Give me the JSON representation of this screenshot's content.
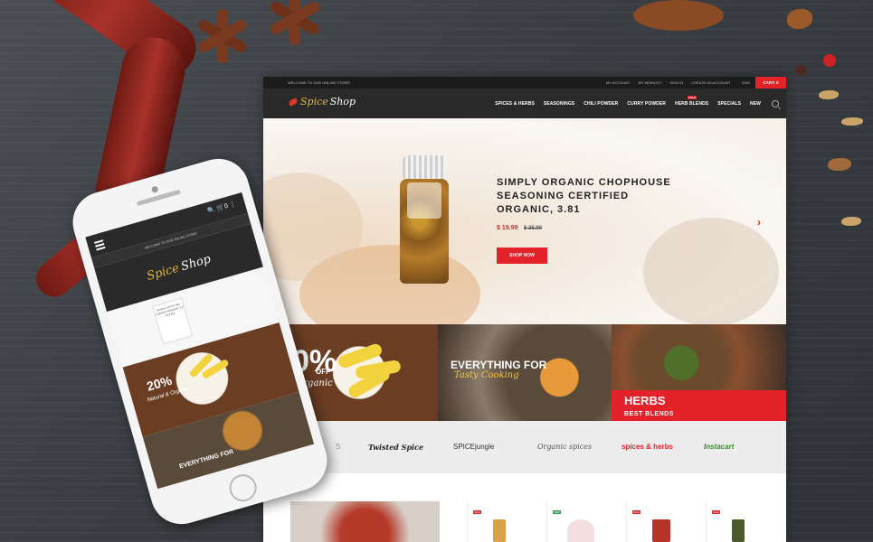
{
  "site": {
    "welcome": "WELCOME TO OUR ONLINE STORE!",
    "top_links": [
      "MY ACCOUNT",
      "MY WISHLIST",
      "SIGN IN",
      "CREATE AN ACCOUNT"
    ],
    "lang": "ENG",
    "cart": "CART: 0",
    "logo_part1": "Spice",
    "logo_part2": "Shop",
    "menu": [
      "SPICES & HERBS",
      "SEASONINGS",
      "CHILI POWDER",
      "CURRY POWDER",
      "HERB BLENDS",
      "SPECIALS",
      "NEW"
    ],
    "menu_badge": "SALE"
  },
  "hero": {
    "title": "SIMPLY ORGANIC CHOPHOUSE SEASONING CERTIFIED ORGANIC, 3.81",
    "price": "$ 19.99",
    "old_price": "$ 25.00",
    "button": "SHOP NOW",
    "next_arrow": "›"
  },
  "banners": {
    "b1_pct": "0%",
    "b1_off": "OFF",
    "b1_text": "& Organic",
    "b2_line1": "EVERYTHING FOR",
    "b2_line2": "Tasty Cooking",
    "b3_line1": "HERBS",
    "b3_line2": "BEST BLENDS"
  },
  "brands": [
    "S",
    "Twisted Spice",
    "SPICEjungle",
    "Organic spices",
    "spices & herbs",
    "Instacart"
  ],
  "product_tags": [
    "SALE",
    "NEW",
    "SALE",
    "SALE"
  ],
  "phone": {
    "welcome": "WELCOME TO OUR ONLINE STORE!",
    "logo_part1": "Spice",
    "logo_part2": "Shop",
    "product_label": "WHOLE SPICE BAY LEAVES POWDER, 1.6 OUNCE",
    "banner_pct": "20%",
    "banner_org": "Natural & Organic",
    "banner2": "EVERYTHING FOR",
    "cart_icons": "🔍 🛒0 ⋮"
  }
}
